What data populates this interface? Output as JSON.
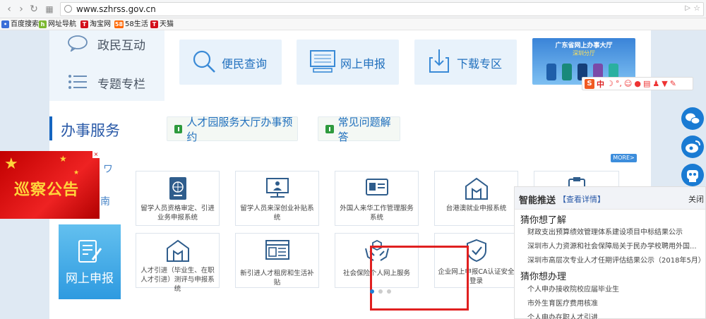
{
  "browser": {
    "url": "www.szhrss.gov.cn",
    "bookmarks": [
      {
        "label": "百度搜索"
      },
      {
        "label": "网址导航"
      },
      {
        "label": "淘宝网"
      },
      {
        "label": "58生活"
      },
      {
        "label": "天猫"
      }
    ]
  },
  "left_nav": {
    "items": [
      {
        "label": "政民互动",
        "icon": "chat-bubble-icon"
      },
      {
        "label": "专题专栏",
        "icon": "list-icon"
      }
    ]
  },
  "quick_tiles": [
    {
      "label": "便民查询",
      "icon": "search-icon"
    },
    {
      "label": "网上申报",
      "icon": "monitor-icon"
    },
    {
      "label": "下载专区",
      "icon": "download-icon"
    }
  ],
  "banner": {
    "title": "广东省网上办事大厅",
    "subtitle": "深圳分厅"
  },
  "section": {
    "title": "办事服务",
    "pills": [
      {
        "label": "人才园服务大厅办事预约"
      },
      {
        "label": "常见问题解答"
      }
    ],
    "more_label": "MORE>"
  },
  "left_fragments": {
    "top": "ワ",
    "mid": "南"
  },
  "ad": {
    "text": "巡察公告",
    "close": "×"
  },
  "services_row1": [
    {
      "label": "留学人员资格审定、引进业务申报系统",
      "icon": "passport-icon"
    },
    {
      "label": "留学人员来深创业补贴系统",
      "icon": "monitor-person-icon"
    },
    {
      "label": "外国人来华工作管理服务系统",
      "icon": "id-card-icon"
    },
    {
      "label": "台港澳就业申报系统",
      "icon": "house-icon"
    },
    {
      "label": "",
      "icon": "clipboard-icon"
    }
  ],
  "services_row2": [
    {
      "label": "人才引进（毕业生、在职人才引进）测评与申报系统",
      "icon": "house-icon"
    },
    {
      "label": "新引进人才租房和生活补贴",
      "icon": "browser-icon"
    },
    {
      "label": "社会保险个人网上服务",
      "icon": "hands-box-icon"
    },
    {
      "label": "企业网上申报CA认证安全登录",
      "icon": "shield-check-icon"
    }
  ],
  "online_apply": {
    "label": "网上申报"
  },
  "push_panel": {
    "title": "智能推送",
    "detail_link": "【查看详情】",
    "close": "关闭",
    "guess_understand": "猜你想了解",
    "understand_items": [
      "财政支出预算绩效管理体系建设项目中标结果公示",
      "深圳市人力资源和社会保障局关于民办学校聘用外国...",
      "深圳市高层次专业人才任期评估结果公示（2018年5月）"
    ],
    "guess_handle": "猜你想办理",
    "handle_items": [
      "个人申办接收院校应届毕业生",
      "市外生育医疗费用核准",
      "个人申办在职人才引进"
    ]
  },
  "sogou": {
    "label": "中"
  },
  "colors": {
    "accent": "#1565c0",
    "highlight_border": "#e02020",
    "social": "#1a7bd3"
  }
}
